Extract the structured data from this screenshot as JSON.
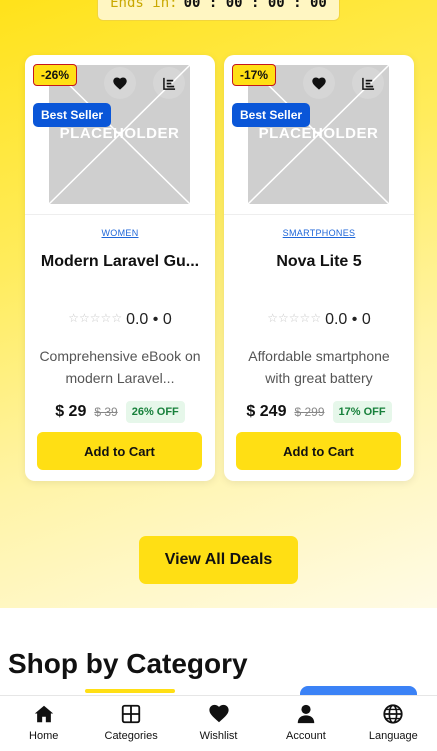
{
  "countdown": {
    "label": "Ends in:",
    "time": "00 : 00 : 00 : 00"
  },
  "products": [
    {
      "discount": "-26%",
      "badge": "Best Seller",
      "placeholder": "PLACEHOLDER",
      "category": "WOMEN",
      "title": "Modern Laravel Gu...",
      "stars": "☆☆☆☆☆",
      "rating": "0.0 • 0",
      "description": "Comprehensive eBook on modern Laravel...",
      "price": "$ 29",
      "old_price": "$ 39",
      "off": "26% OFF",
      "cart_label": "Add to Cart"
    },
    {
      "discount": "-17%",
      "badge": "Best Seller",
      "placeholder": "PLACEHOLDER",
      "category": "SMARTPHONES",
      "title": "Nova Lite 5",
      "stars": "☆☆☆☆☆",
      "rating": "0.0 • 0",
      "description": "Affordable smartphone with great battery",
      "price": "$ 249",
      "old_price": "$ 299",
      "off": "17% OFF",
      "cart_label": "Add to Cart"
    }
  ],
  "view_all_label": "View All Deals",
  "section_title": "Shop by Category",
  "nav": [
    {
      "label": "Home",
      "icon": "home-icon"
    },
    {
      "label": "Categories",
      "icon": "grid-icon"
    },
    {
      "label": "Wishlist",
      "icon": "heart-icon"
    },
    {
      "label": "Account",
      "icon": "user-icon"
    },
    {
      "label": "Language",
      "icon": "globe-icon"
    }
  ],
  "colors": {
    "accent_yellow": "#ffdf14",
    "seller_blue": "#0a56d8",
    "discount_border": "#c4171d",
    "off_green": "#17803b"
  }
}
